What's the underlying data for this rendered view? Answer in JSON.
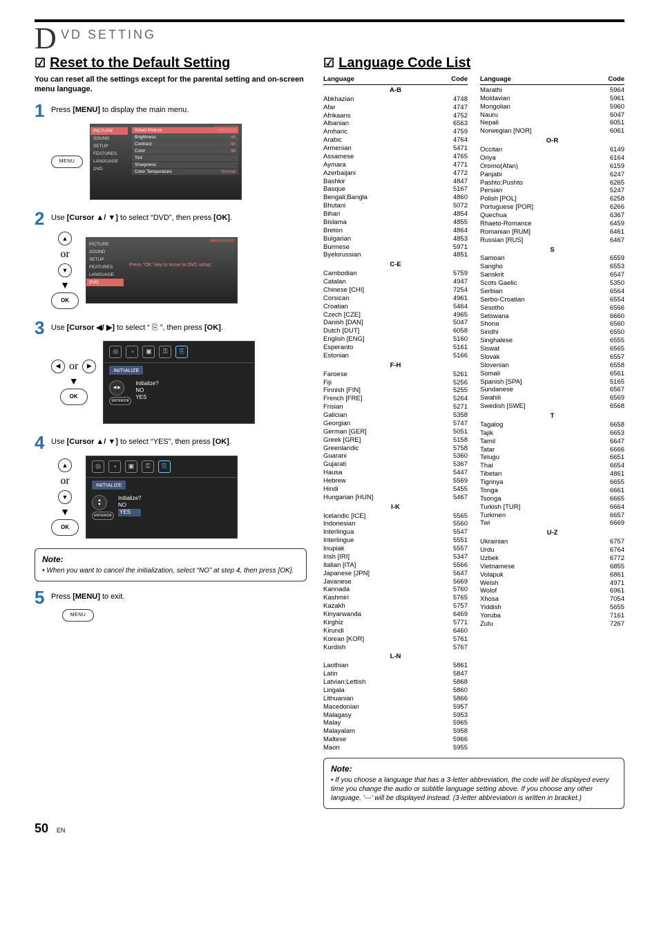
{
  "page_title": {
    "big": "D",
    "rest": "VD  SETTING"
  },
  "left": {
    "heading": "Reset to the Default Setting",
    "intro": "You can reset all the settings except for the parental setting and on-screen menu language.",
    "steps": [
      {
        "num": "1",
        "text_pre": "Press ",
        "bold": "[MENU]",
        "text_post": " to display the main menu."
      },
      {
        "num": "2",
        "text_pre": "Use ",
        "bold": "[Cursor ▲/ ▼]",
        "text_mid": " to select “DVD”, then press ",
        "bold2": "[OK]",
        "text_post": "."
      },
      {
        "num": "3",
        "text_pre": "Use ",
        "bold": "[Cursor ◀/ ▶]",
        "text_mid": " to select “ ",
        "icon": "⎘",
        "text_mid2": " ”, then press ",
        "bold2": "[OK]",
        "text_post": "."
      },
      {
        "num": "4",
        "text_pre": "Use ",
        "bold": "[Cursor ▲/ ▼]",
        "text_mid": " to select “YES”, then press ",
        "bold2": "[OK]",
        "text_post": "."
      },
      {
        "num": "5",
        "text_pre": "Press ",
        "bold": "[MENU]",
        "text_post": " to exit."
      }
    ],
    "remote": {
      "menu": "MENU",
      "ok": "OK",
      "or": "or",
      "enter": "ENTER/OK"
    },
    "tv1": {
      "brand": "MAGNAVOX",
      "side": [
        "PICTURE",
        "SOUND",
        "SETUP",
        "FEATURES",
        "LANGUAGE",
        "DVD"
      ],
      "side_sel": 0,
      "rows": [
        [
          "Smart Picture",
          "Personal"
        ],
        [
          "Brightness",
          "46"
        ],
        [
          "Contrast",
          "48"
        ],
        [
          "Color",
          "48"
        ],
        [
          "Tint",
          ""
        ],
        [
          "Sharpness",
          ""
        ],
        [
          "Color Temperature",
          "Normal"
        ]
      ],
      "rows_sel": 0
    },
    "tv2": {
      "brand": "MAGNAVOX",
      "side": [
        "PICTURE",
        "SOUND",
        "SETUP",
        "FEATURES",
        "LANGUAGE",
        "DVD"
      ],
      "side_sel": 5,
      "msg": "Press \"OK\" key to move to DVD setup"
    },
    "dvd": {
      "tab": "INITIALIZE",
      "question": "Initialize?",
      "no": "NO",
      "yes": "YES",
      "enter": "ENTER/OK"
    },
    "note": {
      "title": "Note:",
      "text": "When you want to cancel the initialization, select “NO” at step 4, then press [OK]."
    }
  },
  "right": {
    "heading": "Language Code List",
    "note": {
      "title": "Note:",
      "text": "If you choose a language that has a 3-letter abbreviation, the code will be displayed every time you change the audio or subtitle language setting above. If you choose any other language, '---' will be displayed instead. (3-letter abbreviation is written in bracket.)"
    },
    "head": {
      "lang": "Language",
      "code": "Code"
    },
    "col1": {
      "groups": [
        {
          "label": "A-B",
          "rows": [
            [
              "Abkhazian",
              "4748"
            ],
            [
              "Afar",
              "4747"
            ],
            [
              "Afrikaans",
              "4752"
            ],
            [
              "Albanian",
              "6563"
            ],
            [
              "Amharic",
              "4759"
            ],
            [
              "Arabic",
              "4764"
            ],
            [
              "Armenian",
              "5471"
            ],
            [
              "Assamese",
              "4765"
            ],
            [
              "Aymara",
              "4771"
            ],
            [
              "Azerbaijani",
              "4772"
            ],
            [
              "Bashkir",
              "4847"
            ],
            [
              "Basque",
              "5167"
            ],
            [
              "Bengali;Bangla",
              "4860"
            ],
            [
              "Bhutani",
              "5072"
            ],
            [
              "Bihari",
              "4854"
            ],
            [
              "Bislama",
              "4855"
            ],
            [
              "Breton",
              "4864"
            ],
            [
              "Bulgarian",
              "4853"
            ],
            [
              "Burmese",
              "5971"
            ],
            [
              "Byelorussian",
              "4851"
            ]
          ]
        },
        {
          "label": "C-E",
          "rows": [
            [
              "Cambodian",
              "5759"
            ],
            [
              "Catalan",
              "4947"
            ],
            [
              "Chinese [CHI]",
              "7254"
            ],
            [
              "Corsican",
              "4961"
            ],
            [
              "Croatian",
              "5464"
            ],
            [
              "Czech [CZE]",
              "4965"
            ],
            [
              "Danish [DAN]",
              "5047"
            ],
            [
              "Dutch [DUT]",
              "6058"
            ],
            [
              "English [ENG]",
              "5160"
            ],
            [
              "Esperanto",
              "5161"
            ],
            [
              "Estonian",
              "5166"
            ]
          ]
        },
        {
          "label": "F-H",
          "rows": [
            [
              "Faroese",
              "5261"
            ],
            [
              "Fiji",
              "5256"
            ],
            [
              "Finnish [FIN]",
              "5255"
            ],
            [
              "French [FRE]",
              "5264"
            ],
            [
              "Frisian",
              "5271"
            ],
            [
              "Galician",
              "5358"
            ],
            [
              "Georgian",
              "5747"
            ],
            [
              "German [GER]",
              "5051"
            ],
            [
              "Greek [GRE]",
              "5158"
            ],
            [
              "Greenlandic",
              "5758"
            ],
            [
              "Guarani",
              "5360"
            ],
            [
              "Gujarati",
              "5367"
            ],
            [
              "Hausa",
              "5447"
            ],
            [
              "Hebrew",
              "5569"
            ],
            [
              "Hindi",
              "5455"
            ],
            [
              "Hungarian [HUN]",
              "5467"
            ]
          ]
        },
        {
          "label": "I-K",
          "rows": [
            [
              "Icelandic [ICE]",
              "5565"
            ],
            [
              "Indonesian",
              "5560"
            ],
            [
              "Interlingua",
              "5547"
            ],
            [
              "Interlingue",
              "5551"
            ],
            [
              "Inupiak",
              "5557"
            ],
            [
              "Irish [IRI]",
              "5347"
            ],
            [
              "Italian [ITA]",
              "5566"
            ],
            [
              "Japanese [JPN]",
              "5647"
            ],
            [
              "Javanese",
              "5669"
            ],
            [
              "Kannada",
              "5760"
            ],
            [
              "Kashmiri",
              "5765"
            ],
            [
              "Kazakh",
              "5757"
            ],
            [
              "Kinyarwanda",
              "6469"
            ],
            [
              "Kirghiz",
              "5771"
            ],
            [
              "Kirundi",
              "6460"
            ],
            [
              "Korean [KOR]",
              "5761"
            ],
            [
              "Kurdish",
              "5767"
            ]
          ]
        },
        {
          "label": "L-N",
          "rows": [
            [
              "Laothian",
              "5861"
            ],
            [
              "Latin",
              "5847"
            ],
            [
              "Latvian;Lettish",
              "5868"
            ],
            [
              "Lingala",
              "5860"
            ],
            [
              "Lithuanian",
              "5866"
            ],
            [
              "Macedonian",
              "5957"
            ],
            [
              "Malagasy",
              "5953"
            ],
            [
              "Malay",
              "5965"
            ],
            [
              "Malayalam",
              "5958"
            ],
            [
              "Maltese",
              "5966"
            ],
            [
              "Maori",
              "5955"
            ]
          ]
        }
      ]
    },
    "col2": {
      "groups": [
        {
          "label": "",
          "rows": [
            [
              "Marathi",
              "5964"
            ],
            [
              "Moldavian",
              "5961"
            ],
            [
              "Mongolian",
              "5960"
            ],
            [
              "Nauru",
              "6047"
            ],
            [
              "Nepali",
              "6051"
            ],
            [
              "Norwegian [NOR]",
              "6061"
            ]
          ]
        },
        {
          "label": "O-R",
          "rows": [
            [
              "Occitan",
              "6149"
            ],
            [
              "Oriya",
              "6164"
            ],
            [
              "Oromo(Afan)",
              "6159"
            ],
            [
              "Panjabi",
              "6247"
            ],
            [
              "Pashto;Pushto",
              "6265"
            ],
            [
              "Persian",
              "5247"
            ],
            [
              "Polish [POL]",
              "6258"
            ],
            [
              "Portuguese [POR]",
              "6266"
            ],
            [
              "Quechua",
              "6367"
            ],
            [
              "Rhaeto-Romance",
              "6459"
            ],
            [
              "Romanian [RUM]",
              "6461"
            ],
            [
              "Russian [RUS]",
              "6467"
            ]
          ]
        },
        {
          "label": "S",
          "rows": [
            [
              "Samoan",
              "6559"
            ],
            [
              "Sangho",
              "6553"
            ],
            [
              "Sanskrit",
              "6547"
            ],
            [
              "Scots Gaelic",
              "5350"
            ],
            [
              "Serbian",
              "6564"
            ],
            [
              "Serbo-Croatian",
              "6554"
            ],
            [
              "Sesotho",
              "6566"
            ],
            [
              "Setswana",
              "6660"
            ],
            [
              "Shona",
              "6560"
            ],
            [
              "Sindhi",
              "6550"
            ],
            [
              "Singhalese",
              "6555"
            ],
            [
              "Siswat",
              "6565"
            ],
            [
              "Slovak",
              "6557"
            ],
            [
              "Slovenian",
              "6558"
            ],
            [
              "Somali",
              "6561"
            ],
            [
              "Spanish [SPA]",
              "5165"
            ],
            [
              "Sundanese",
              "6567"
            ],
            [
              "Swahili",
              "6569"
            ],
            [
              "Swedish [SWE]",
              "6568"
            ]
          ]
        },
        {
          "label": "T",
          "rows": [
            [
              "Tagalog",
              "6658"
            ],
            [
              "Tajik",
              "6653"
            ],
            [
              "Tamil",
              "6647"
            ],
            [
              "Tatar",
              "6666"
            ],
            [
              "Telugu",
              "6651"
            ],
            [
              "Thai",
              "6654"
            ],
            [
              "Tibetan",
              "4861"
            ],
            [
              "Tigrinya",
              "6655"
            ],
            [
              "Tonga",
              "6661"
            ],
            [
              "Tsonga",
              "6665"
            ],
            [
              "Turkish [TUR]",
              "6664"
            ],
            [
              "Turkmen",
              "6657"
            ],
            [
              "Twi",
              "6669"
            ]
          ]
        },
        {
          "label": "U-Z",
          "rows": [
            [
              "Ukrainian",
              "6757"
            ],
            [
              "Urdu",
              "6764"
            ],
            [
              "Uzbek",
              "6772"
            ],
            [
              "Vietnamese",
              "6855"
            ],
            [
              "Volapuk",
              "6861"
            ],
            [
              "Welsh",
              "4971"
            ],
            [
              "Wolof",
              "6961"
            ],
            [
              "Xhosa",
              "7054"
            ],
            [
              "Yiddish",
              "5655"
            ],
            [
              "Yoruba",
              "7161"
            ],
            [
              "Zulu",
              "7267"
            ]
          ]
        }
      ]
    }
  },
  "page_number": {
    "num": "50",
    "en": "EN"
  }
}
